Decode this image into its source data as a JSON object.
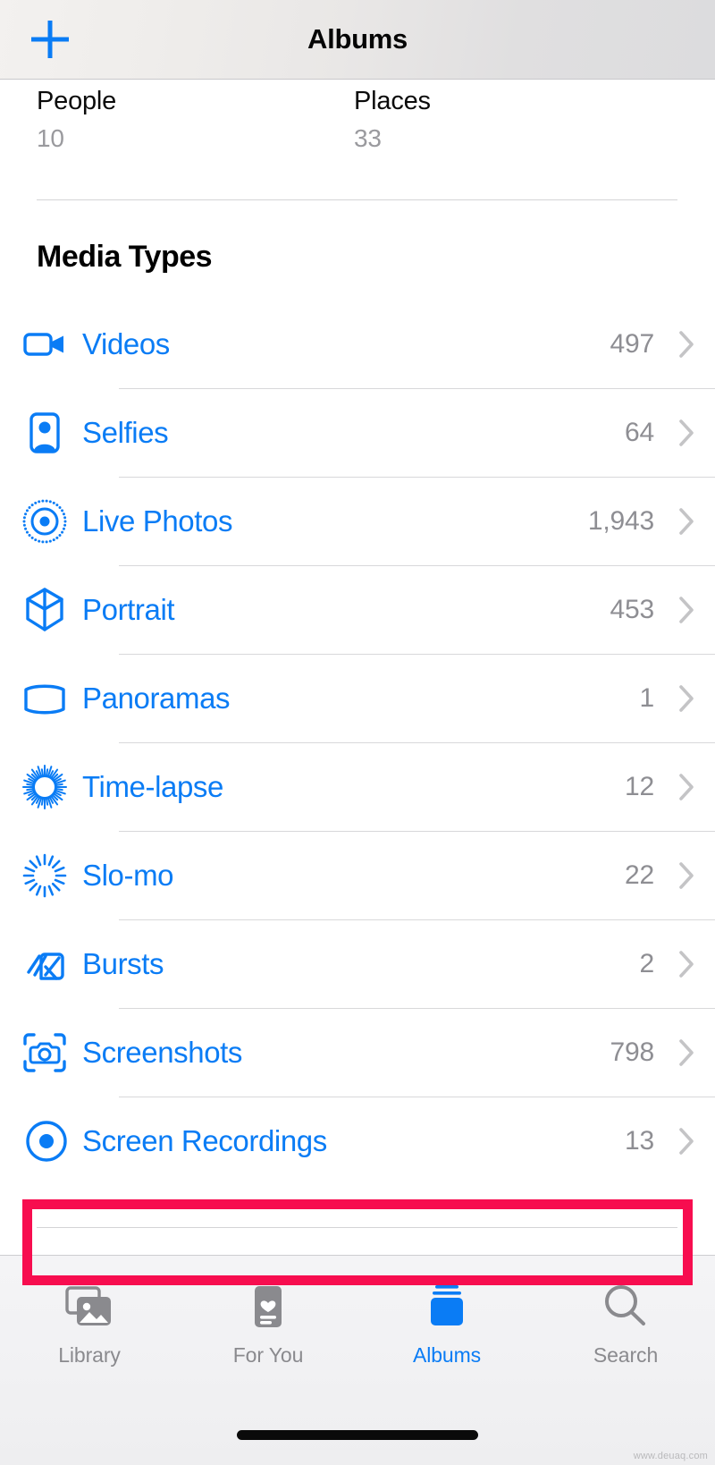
{
  "navbar": {
    "title": "Albums",
    "add_button_icon": "plus-icon"
  },
  "people_places": {
    "people_label": "People",
    "people_count": "10",
    "places_label": "Places",
    "places_count": "33"
  },
  "section": {
    "header": "Media Types"
  },
  "colors": {
    "accent_blue": "#0a7cf5",
    "highlight_red": "#f70d4f",
    "count_gray": "#8e8e93"
  },
  "media_types": [
    {
      "icon": "video-camera-icon",
      "label": "Videos",
      "count": "497"
    },
    {
      "icon": "selfie-person-icon",
      "label": "Selfies",
      "count": "64"
    },
    {
      "icon": "live-photo-icon",
      "label": "Live Photos",
      "count": "1,943"
    },
    {
      "icon": "portrait-cube-icon",
      "label": "Portrait",
      "count": "453"
    },
    {
      "icon": "panorama-icon",
      "label": "Panoramas",
      "count": "1"
    },
    {
      "icon": "timelapse-icon",
      "label": "Time-lapse",
      "count": "12"
    },
    {
      "icon": "slomo-icon",
      "label": "Slo-mo",
      "count": "22"
    },
    {
      "icon": "bursts-icon",
      "label": "Bursts",
      "count": "2"
    },
    {
      "icon": "screenshot-camera-icon",
      "label": "Screenshots",
      "count": "798"
    },
    {
      "icon": "record-circle-icon",
      "label": "Screen Recordings",
      "count": "13"
    }
  ],
  "highlighted_row_index": 9,
  "tabbar": {
    "tabs": [
      {
        "icon": "photos-stack-icon",
        "label": "Library",
        "active": false
      },
      {
        "icon": "heart-card-icon",
        "label": "For You",
        "active": false
      },
      {
        "icon": "albums-book-icon",
        "label": "Albums",
        "active": true
      },
      {
        "icon": "search-icon",
        "label": "Search",
        "active": false
      }
    ]
  },
  "watermark": "www.deuaq.com"
}
